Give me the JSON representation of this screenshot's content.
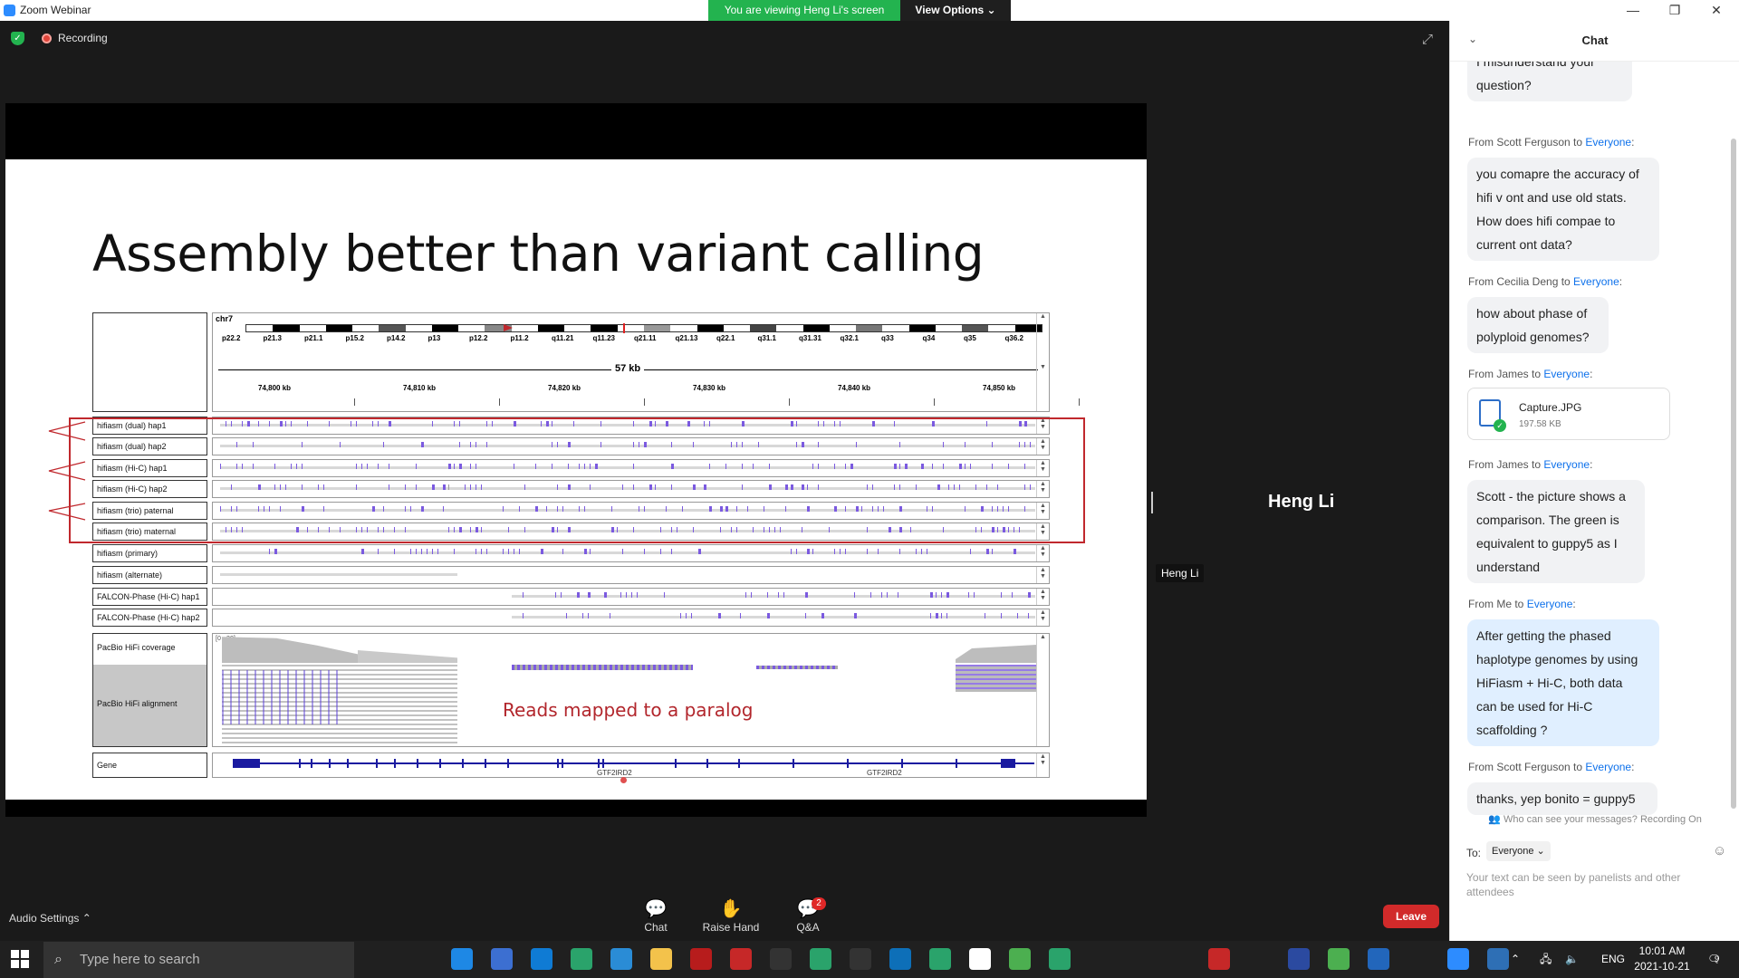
{
  "window": {
    "title": "Zoom Webinar",
    "minimize": "—",
    "restore": "❐",
    "close": "✕"
  },
  "banner": {
    "viewing": "You are viewing Heng Li's screen",
    "view_options": "View Options ⌄"
  },
  "meeting": {
    "recording_label": "Recording",
    "presenter_name": "Heng Li",
    "presenter_tag": "Heng Li"
  },
  "slide": {
    "title": "Assembly better than variant calling",
    "annotation": "Reads mapped to a paralog",
    "chrom": "chr7",
    "span": "57 kb",
    "bands": [
      "p22.2",
      "p21.3",
      "p21.1",
      "p15.2",
      "p14.2",
      "p13",
      "p12.2",
      "p11.2",
      "q11.21",
      "q11.23",
      "q21.11",
      "q21.13",
      "q22.1",
      "q31.1",
      "q31.31",
      "q32.1",
      "q33",
      "q34",
      "q35",
      "q36.2"
    ],
    "kb_ticks": [
      "74,800 kb",
      "74,810 kb",
      "74,820 kb",
      "74,830 kb",
      "74,840 kb",
      "74,850 kb"
    ],
    "tracks": [
      "hifiasm (dual) hap1",
      "hifiasm (dual) hap2",
      "hifiasm (Hi-C) hap1",
      "hifiasm (Hi-C) hap2",
      "hifiasm (trio) paternal",
      "hifiasm (trio) maternal",
      "hifiasm (primary)",
      "hifiasm (alternate)",
      "FALCON-Phase (Hi-C) hap1",
      "FALCON-Phase (Hi-C) hap2"
    ],
    "coverage_label": "PacBio HiFi coverage",
    "coverage_range": "[0 - 30]",
    "alignment_label": "PacBio HiFi alignment",
    "gene_label": "Gene",
    "gene_names": [
      "GTF2IRD2",
      "GTF2IRD2"
    ]
  },
  "toolbar": {
    "audio_settings": "Audio Settings ⌃",
    "chat": "Chat",
    "raise_hand": "Raise Hand",
    "qa": "Q&A",
    "qa_badge": "2",
    "leave": "Leave"
  },
  "chat": {
    "title": "Chat",
    "messages": [
      {
        "from": "",
        "to": "",
        "text_lines": [
          "I misunderstand your",
          "question?"
        ]
      },
      {
        "from": "From Scott Ferguson to ",
        "to": "Everyone",
        "text_lines": [
          "you comapre the accuracy of",
          "hifi v ont and use old stats.",
          "How does hifi compae to",
          "current ont data?"
        ]
      },
      {
        "from": "From Cecilia Deng to ",
        "to": "Everyone",
        "text_lines": [
          "how about phase of",
          "polyploid genomes?"
        ]
      },
      {
        "from": "From James to ",
        "to": "Everyone",
        "file_name": "Capture.JPG",
        "file_size": "197.58 KB"
      },
      {
        "from": "From James to ",
        "to": "Everyone",
        "text_lines": [
          "Scott - the picture shows a",
          "comparison. The green is",
          "equivalent to guppy5 as I",
          "understand"
        ]
      },
      {
        "from": "From Me to ",
        "to": "Everyone",
        "text_lines": [
          "After getting the phased",
          "haplotype genomes by using",
          "HiFiasm + Hi-C, both data",
          "can be used for Hi-C",
          "scaffolding ?"
        ]
      },
      {
        "from": "From Scott Ferguson to ",
        "to": "Everyone",
        "text_lines": [
          "thanks, yep bonito = guppy5"
        ]
      }
    ],
    "visibility_note": "Who can see your messages? Recording On",
    "to_label": "To:",
    "to_value": "Everyone ⌄",
    "input_placeholder": "Your text can be seen by panelists and other attendees"
  },
  "taskbar": {
    "search_placeholder": "Type here to search",
    "language": "ENG",
    "time": "10:01 AM",
    "date": "2021-10-21",
    "notification_count": "9"
  }
}
